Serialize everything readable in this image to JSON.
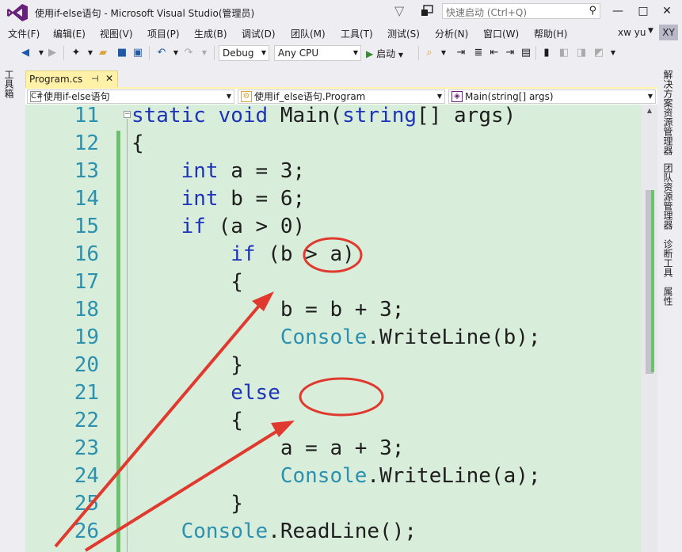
{
  "window": {
    "title": "使用if-else语句 - Microsoft Visual Studio(管理员)",
    "quick_launch_placeholder": "快速启动 (Ctrl+Q)",
    "minimize": "—",
    "maximize": "□",
    "close": "✕"
  },
  "menu": [
    "文件(F)",
    "编辑(E)",
    "视图(V)",
    "项目(P)",
    "生成(B)",
    "调试(D)",
    "团队(M)",
    "工具(T)",
    "测试(S)",
    "分析(N)",
    "窗口(W)",
    "帮助(H)"
  ],
  "account": {
    "name": "xw yu",
    "initials": "XY"
  },
  "toolbar": {
    "configuration": "Debug",
    "platform": "Any CPU",
    "start_label": "启动",
    "start_icon": "▶"
  },
  "side_panels": {
    "toolbox": "工具箱",
    "right_tabs": [
      "解决方案资源管理器",
      "团队资源管理器",
      "诊断工具",
      "属性"
    ]
  },
  "document": {
    "tab_title": "Program.cs",
    "pin": "⊣",
    "close": "✕",
    "nav": {
      "project": "使用if-else语句",
      "class": "使用if_else语句.Program",
      "member": "Main(string[] args)"
    }
  },
  "editor": {
    "lines": [
      {
        "num": "11",
        "indent": "",
        "tokens": [
          [
            "kw",
            "static"
          ],
          [
            "p",
            " "
          ],
          [
            "kw",
            "void"
          ],
          [
            "p",
            " Main("
          ],
          [
            "kw",
            "string"
          ],
          [
            "p",
            "[] args)"
          ]
        ]
      },
      {
        "num": "12",
        "indent": "",
        "tokens": [
          [
            "p",
            "{"
          ]
        ]
      },
      {
        "num": "13",
        "indent": "    ",
        "tokens": [
          [
            "kw",
            "int"
          ],
          [
            "p",
            " a = 3;"
          ]
        ]
      },
      {
        "num": "14",
        "indent": "    ",
        "tokens": [
          [
            "kw",
            "int"
          ],
          [
            "p",
            " b = 6;"
          ]
        ]
      },
      {
        "num": "15",
        "indent": "    ",
        "tokens": [
          [
            "kw",
            "if"
          ],
          [
            "p",
            " (a > 0)"
          ]
        ]
      },
      {
        "num": "16",
        "indent": "        ",
        "tokens": [
          [
            "kw",
            "if"
          ],
          [
            "p",
            " (b > a)"
          ]
        ]
      },
      {
        "num": "17",
        "indent": "        ",
        "tokens": [
          [
            "p",
            "{"
          ]
        ]
      },
      {
        "num": "18",
        "indent": "            ",
        "tokens": [
          [
            "p",
            "b = b + 3;"
          ]
        ]
      },
      {
        "num": "19",
        "indent": "            ",
        "tokens": [
          [
            "ty",
            "Console"
          ],
          [
            "p",
            ".WriteLine(b);"
          ]
        ]
      },
      {
        "num": "20",
        "indent": "        ",
        "tokens": [
          [
            "p",
            "}"
          ]
        ]
      },
      {
        "num": "21",
        "indent": "        ",
        "tokens": [
          [
            "kw",
            "else"
          ]
        ]
      },
      {
        "num": "22",
        "indent": "        ",
        "tokens": [
          [
            "p",
            "{"
          ]
        ]
      },
      {
        "num": "23",
        "indent": "            ",
        "tokens": [
          [
            "p",
            "a = a + 3;"
          ]
        ]
      },
      {
        "num": "24",
        "indent": "            ",
        "tokens": [
          [
            "ty",
            "Console"
          ],
          [
            "p",
            ".WriteLine(a);"
          ]
        ]
      },
      {
        "num": "25",
        "indent": "        ",
        "tokens": [
          [
            "p",
            "}"
          ]
        ]
      },
      {
        "num": "26",
        "indent": "    ",
        "tokens": [
          [
            "ty",
            "Console"
          ],
          [
            "p",
            ".ReadLine();"
          ]
        ]
      }
    ]
  },
  "colors": {
    "editor_background": "#d9eddb",
    "keyword": "#1d33b8",
    "type": "#2b91af",
    "line_number": "#2b91af",
    "change_bar": "#6cc16c",
    "annotation": "#e03a2f",
    "tab_active": "#fff1a8"
  },
  "icons": {
    "search": "search-icon",
    "filter": "filter-icon",
    "back": "back-icon",
    "forward": "forward-icon",
    "new_project": "new-project-icon",
    "open": "open-folder-icon",
    "save": "save-icon",
    "save_all": "save-all-icon",
    "undo": "undo-icon",
    "redo": "redo-icon"
  }
}
